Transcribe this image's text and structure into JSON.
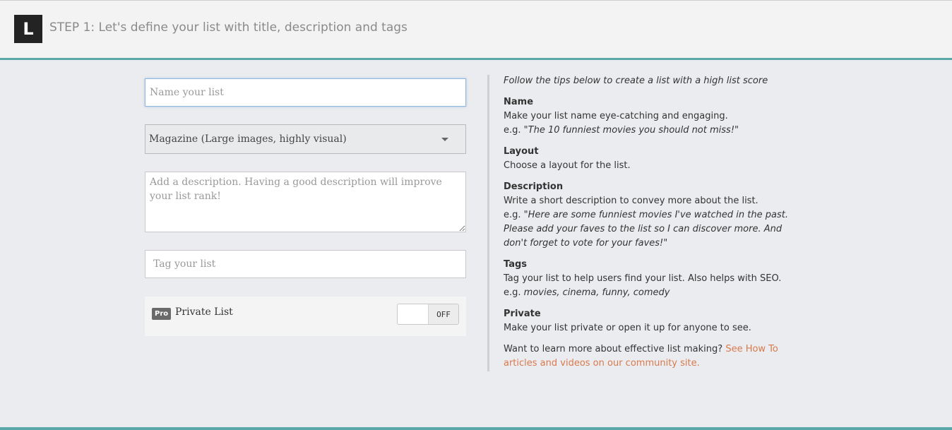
{
  "header": {
    "logo_letter": "L",
    "step_title": "STEP 1: Let's define your list with title, description and tags"
  },
  "form": {
    "name_placeholder": "Name your list",
    "name_value": "",
    "layout_selected": "Magazine (Large images, highly visual)",
    "description_placeholder": "Add a description. Having a good description will improve your list rank!",
    "description_value": "",
    "tag_placeholder": "Tag your list",
    "private": {
      "badge": "Pro",
      "label": "Private List",
      "toggle_state": "OFF"
    }
  },
  "tips": {
    "intro": "Follow the tips below to create a list with a high list score",
    "name": {
      "heading": "Name",
      "text": "Make your list name eye-catching and engaging.",
      "example_prefix": "e.g.",
      "example": "\"The 10 funniest movies you should not miss!\""
    },
    "layout": {
      "heading": "Layout",
      "text": "Choose a layout for the list."
    },
    "description": {
      "heading": "Description",
      "text": "Write a short description to convey more about the list.",
      "example_prefix": "e.g.",
      "example": "\"Here are some funniest movies I've watched in the past. Please add your faves to the list so I can discover more. And don't forget to vote for your faves!\""
    },
    "tags": {
      "heading": "Tags",
      "text": "Tag your list to help users find your list. Also helps with SEO.",
      "example_prefix": "e.g.",
      "example": "movies, cinema, funny, comedy"
    },
    "private": {
      "heading": "Private",
      "text": "Make your list private or open it up for anyone to see."
    },
    "learn_more": "Want to learn more about effective list making?",
    "learn_more_link": "See How To articles and videos on our community site."
  },
  "colors": {
    "accent": "#5aa9a8",
    "link": "#d87a4e",
    "background": "#ebecef"
  }
}
